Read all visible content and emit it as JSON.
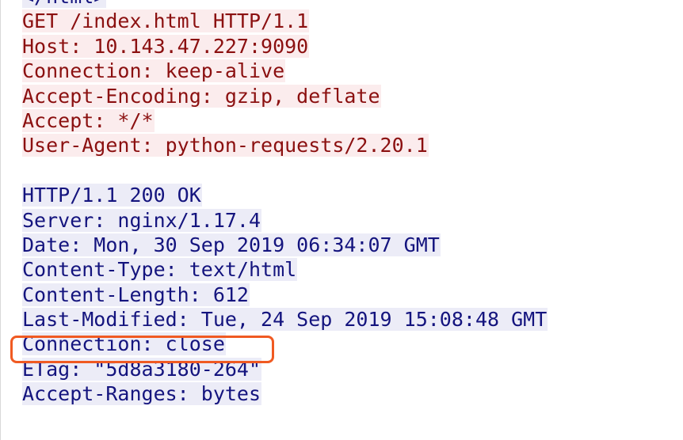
{
  "previous_line": "</html>",
  "request": {
    "lines": [
      "GET /index.html HTTP/1.1",
      "Host: 10.143.47.227:9090",
      "Connection: keep-alive",
      "Accept-Encoding: gzip, deflate",
      "Accept: */*",
      "User-Agent: python-requests/2.20.1"
    ]
  },
  "response": {
    "lines": [
      "HTTP/1.1 200 OK",
      "Server: nginx/1.17.4",
      "Date: Mon, 30 Sep 2019 06:34:07 GMT",
      "Content-Type: text/html",
      "Content-Length: 612",
      "Last-Modified: Tue, 24 Sep 2019 15:08:48 GMT",
      "Connection: close",
      "ETag: \"5d8a3180-264\"",
      "Accept-Ranges: bytes"
    ]
  },
  "colors": {
    "client_text": "#8b1010",
    "client_bg": "#fbeced",
    "server_text": "#14147e",
    "server_bg": "#ececf7",
    "annotation_box": "#f05a22"
  }
}
